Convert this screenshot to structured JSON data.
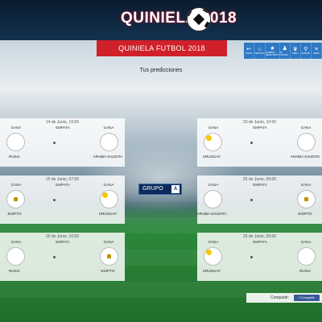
{
  "header": {
    "logo_text": "QUINIELA 2018"
  },
  "title": "QUINIELA FUTBOL 2018",
  "toolbar": [
    {
      "icon": "back-icon",
      "glyph": "↩",
      "label": "ATRÁS"
    },
    {
      "icon": "home-icon",
      "glyph": "⌂",
      "label": "PRINCIPAL"
    },
    {
      "icon": "star-icon",
      "glyph": "★",
      "label": "CAMBIAR RESULTADOS"
    },
    {
      "icon": "user-icon",
      "glyph": "♟",
      "label": "MI CUENTA"
    },
    {
      "icon": "trophy-icon",
      "glyph": "♛",
      "label": "TABLA"
    },
    {
      "icon": "search-icon",
      "glyph": "⚲",
      "label": "BUSCAR"
    },
    {
      "icon": "menu-icon",
      "glyph": "≡",
      "label": "MENÚ"
    }
  ],
  "predictions_label": "Tus predicciones",
  "group": {
    "label": "GRUPO",
    "letter": "A"
  },
  "matches": [
    {
      "date": "14 de Junio, 10:00",
      "gana1": "GANA",
      "empata": "EMPATA",
      "gana2": "GANA",
      "team1": "RUSIA",
      "team2": "ARABIA SAUDITA",
      "flag1": "ru",
      "flag2": "sa"
    },
    {
      "date": "20 de Junio, 10:00",
      "gana1": "GANA",
      "empata": "EMPATA",
      "gana2": "GANA",
      "team1": "URUGUAY",
      "team2": "ARABIA SAUDITA",
      "flag1": "uy",
      "flag2": "sa"
    },
    {
      "date": "15 de Junio, 07:00",
      "gana1": "GANA",
      "empata": "EMPATA",
      "gana2": "GANA",
      "team1": "EGIPTO",
      "team2": "URUGUAY",
      "flag1": "eg",
      "flag2": "uy"
    },
    {
      "date": "25 de Junio, 09:00",
      "gana1": "GANA",
      "empata": "EMPATA",
      "gana2": "GANA",
      "team1": "ARABIA SAUDITA",
      "team2": "EGIPTO",
      "flag1": "sa",
      "flag2": "eg"
    },
    {
      "date": "20 de Junio, 10:00",
      "gana1": "GANA",
      "empata": "EMPATA",
      "gana2": "GANA",
      "team1": "RUSIA",
      "team2": "EGIPTO",
      "flag1": "ru",
      "flag2": "eg"
    },
    {
      "date": "25 de Junio, 09:00",
      "gana1": "GANA",
      "empata": "EMPATA",
      "gana2": "GANA",
      "team1": "URUGUAY",
      "team2": "RUSIA",
      "flag1": "uy",
      "flag2": "ru"
    }
  ],
  "share": {
    "label": "Compartir:",
    "button": "Compartir"
  },
  "colors": {
    "title_bar": "#d0202a",
    "toolbar": "#2e78c4",
    "header": "#0a1c30"
  }
}
